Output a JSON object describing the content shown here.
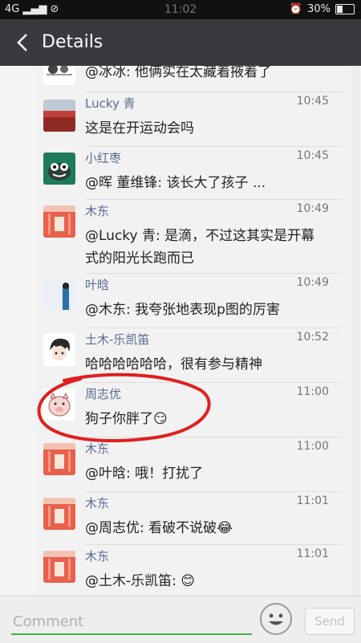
{
  "status_bar": {
    "network": "4G",
    "time": "11:02",
    "battery": "30%"
  },
  "header": {
    "title": "Details"
  },
  "messages": [
    {
      "name": "",
      "time": "",
      "text": "@冰冰: 他俩实在太藏着掖着了"
    },
    {
      "name": "Lucky 青",
      "time": "10:45",
      "text": "这是在开运动会吗"
    },
    {
      "name": "小红枣",
      "time": "10:45",
      "text": "@晖 董维锋: 该长大了孩子 ..."
    },
    {
      "name": "木东",
      "time": "10:49",
      "text": "@Lucky 青: 是滴，不过这其实是开幕式的阳光长跑而已"
    },
    {
      "name": "叶晗",
      "time": "10:49",
      "text": "@木东: 我夸张地表现p图的厉害"
    },
    {
      "name": "土木-乐凯笛",
      "time": "10:52",
      "text": "哈哈哈哈哈哈，很有参与精神"
    },
    {
      "name": "周志优",
      "time": "11:00",
      "text": "狗子你胖了😏"
    },
    {
      "name": "木东",
      "time": "11:00",
      "text": "@叶晗: 哦！打扰了"
    },
    {
      "name": "木东",
      "time": "11:01",
      "text": "@周志优: 看破不说破😂"
    },
    {
      "name": "木东",
      "time": "11:01",
      "text": "@土木-乐凯笛: 😊"
    }
  ],
  "bottom": {
    "placeholder": "Comment",
    "send_label": "Send"
  },
  "colors": {
    "header_bg": "#393a3f",
    "name_color": "#576b95",
    "annotation": "#e02020",
    "accent": "#46b246"
  }
}
